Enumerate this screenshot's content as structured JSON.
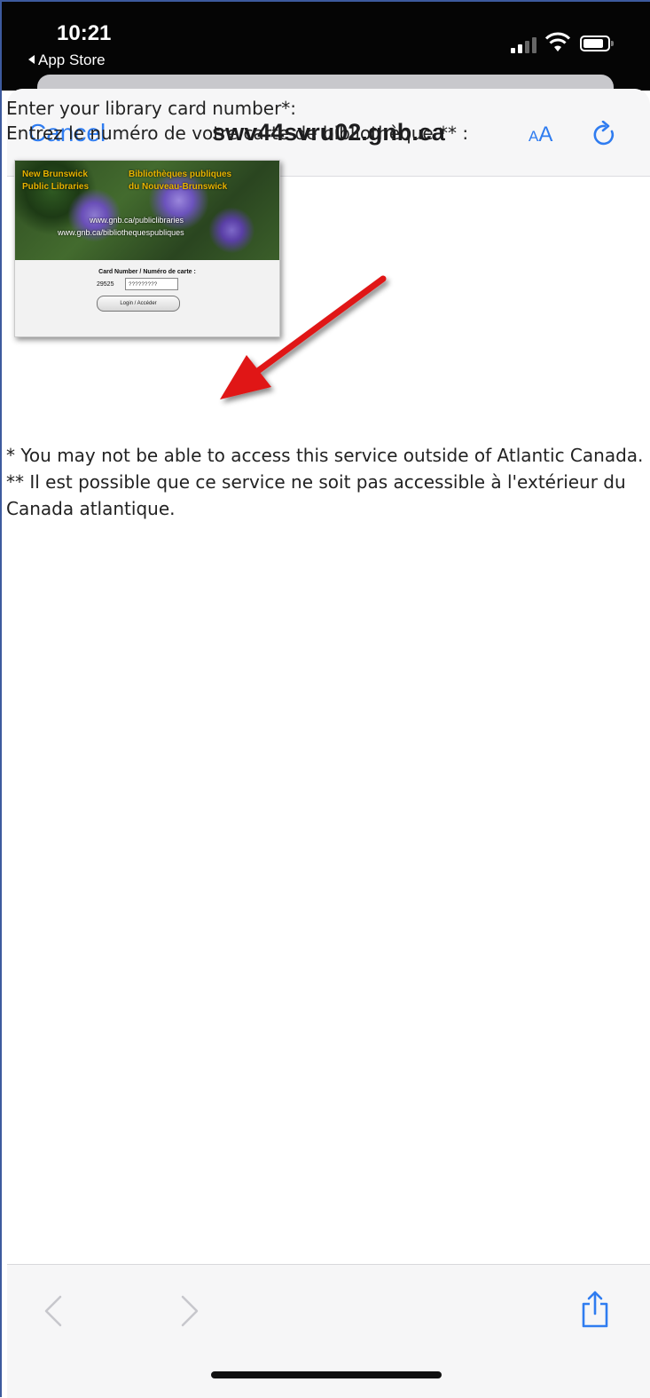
{
  "status_bar": {
    "time": "10:21",
    "back_app_label": "App Store"
  },
  "navbar": {
    "cancel_label": "Cancel",
    "url": "swv44svru02.gnb.ca",
    "text_size_small": "A",
    "text_size_big": "A",
    "reload_icon": "reload-icon"
  },
  "content": {
    "prompt_en": "Enter your library card number*:",
    "prompt_fr": "Entrez le numéro de votre carte de bibliothèque ** :",
    "card_image": {
      "title_en_1": "New Brunswick",
      "title_en_2": "Public Libraries",
      "title_fr_1": "Bibliothèques publiques",
      "title_fr_2": "du Nouveau-Brunswick",
      "url_en": "www.gnb.ca/publiclibraries",
      "url_fr": "www.gnb.ca/bibliothequespubliques",
      "field_label": "Card Number / Numéro de carte :",
      "card_prefix": "29525",
      "card_placeholder": "?????????",
      "login_label": "Login / Accéder"
    },
    "note_en": "* You may not be able to access this service outside of Atlantic Canada.",
    "note_fr_1": "** Il est possible que ce service ne soit pas accessible à l'extérieur du",
    "note_fr_2": "Canada atlantique."
  },
  "toolbar": {
    "back_icon": "chevron-left-icon",
    "forward_icon": "chevron-right-icon",
    "share_icon": "share-icon"
  },
  "colors": {
    "accent": "#2f7cf0",
    "arrow": "#e01515"
  }
}
